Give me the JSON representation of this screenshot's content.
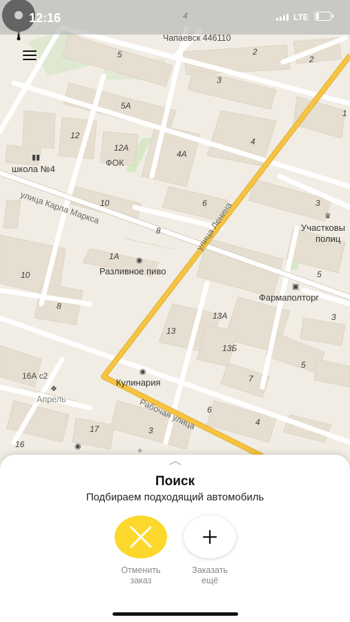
{
  "status_bar": {
    "time": "12:16",
    "network": "LTE"
  },
  "map": {
    "addresses": [
      "4",
      "Чапаевск 446110",
      "5",
      "2",
      "2",
      "3",
      "1",
      "5А",
      "12",
      "12А",
      "ФОК",
      "4А",
      "4",
      "школа №4",
      "10",
      "6",
      "3",
      "8",
      "1А",
      "10",
      "8",
      "13А",
      "5",
      "3",
      "13",
      "13Б",
      "5",
      "16А с2",
      "Апрель",
      "6",
      "4",
      "7",
      "17",
      "3",
      "16",
      "Участковы",
      "полиц"
    ],
    "streets": {
      "karla_marksa": "улица Карла Маркса",
      "lenina": "улица Ленина",
      "rabochaya": "Рабочая улица"
    },
    "pois": {
      "beer": "Разливное пиво",
      "pharmacy": "Фармаполторг",
      "kulinariya": "Кулинария"
    }
  },
  "sheet": {
    "title": "Поиск",
    "subtitle": "Подбираем подходящий автомобиль",
    "cancel_label_1": "Отменить",
    "cancel_label_2": "заказ",
    "more_label_1": "Заказать",
    "more_label_2": "ещё"
  },
  "icons": {
    "menu": "hamburger-icon",
    "pin": "location-pin-icon",
    "cancel": "close-icon",
    "add": "plus-icon"
  },
  "colors": {
    "accent": "#fbd82b",
    "main_road": "#f6c443",
    "map_bg": "#f1ede4"
  }
}
